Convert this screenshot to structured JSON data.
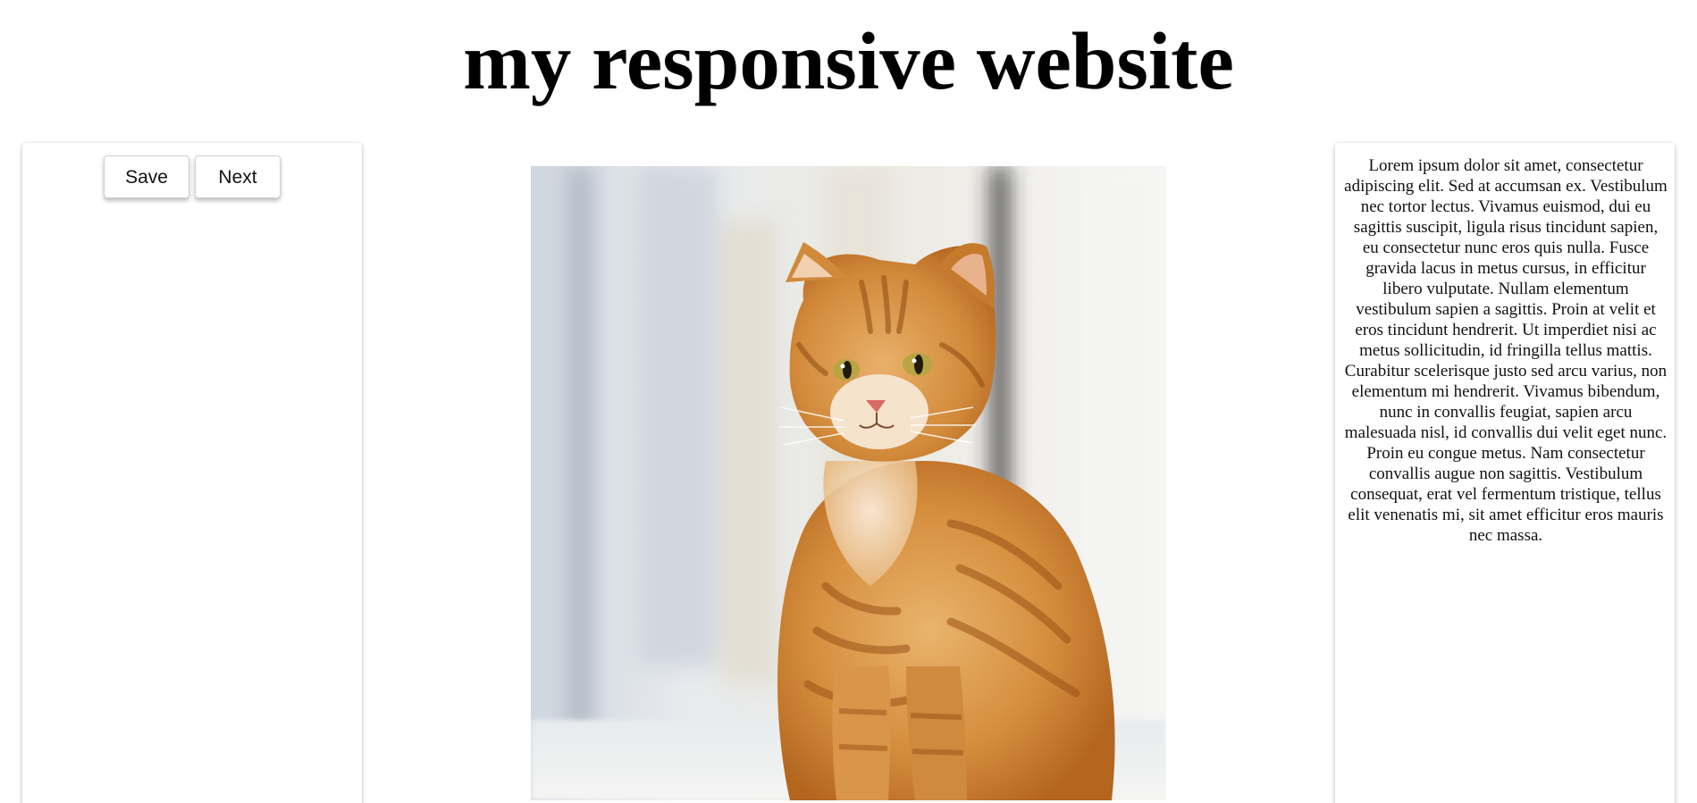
{
  "header": {
    "title": "my responsive website"
  },
  "left_panel": {
    "buttons": {
      "save_label": "Save",
      "next_label": "Next"
    }
  },
  "main": {
    "image": {
      "alt": "orange tabby cat sitting by a window"
    }
  },
  "right_panel": {
    "text": "Lorem ipsum dolor sit amet, consectetur adipiscing elit. Sed at accumsan ex. Vestibulum nec tortor lectus. Vivamus euismod, dui eu sagittis suscipit, ligula risus tincidunt sapien, eu consectetur nunc eros quis nulla. Fusce gravida lacus in metus cursus, in efficitur libero vulputate. Nullam elementum vestibulum sapien a sagittis. Proin at velit et eros tincidunt hendrerit. Ut imperdiet nisi ac metus sollicitudin, id fringilla tellus mattis. Curabitur scelerisque justo sed arcu varius, non elementum mi hendrerit. Vivamus bibendum, nunc in convallis feugiat, sapien arcu malesuada nisl, id convallis dui velit eget nunc. Proin eu congue metus. Nam consectetur convallis augue non sagittis. Vestibulum consequat, erat vel fermentum tristique, tellus elit venenatis mi, sit amet efficitur eros mauris nec massa."
  }
}
